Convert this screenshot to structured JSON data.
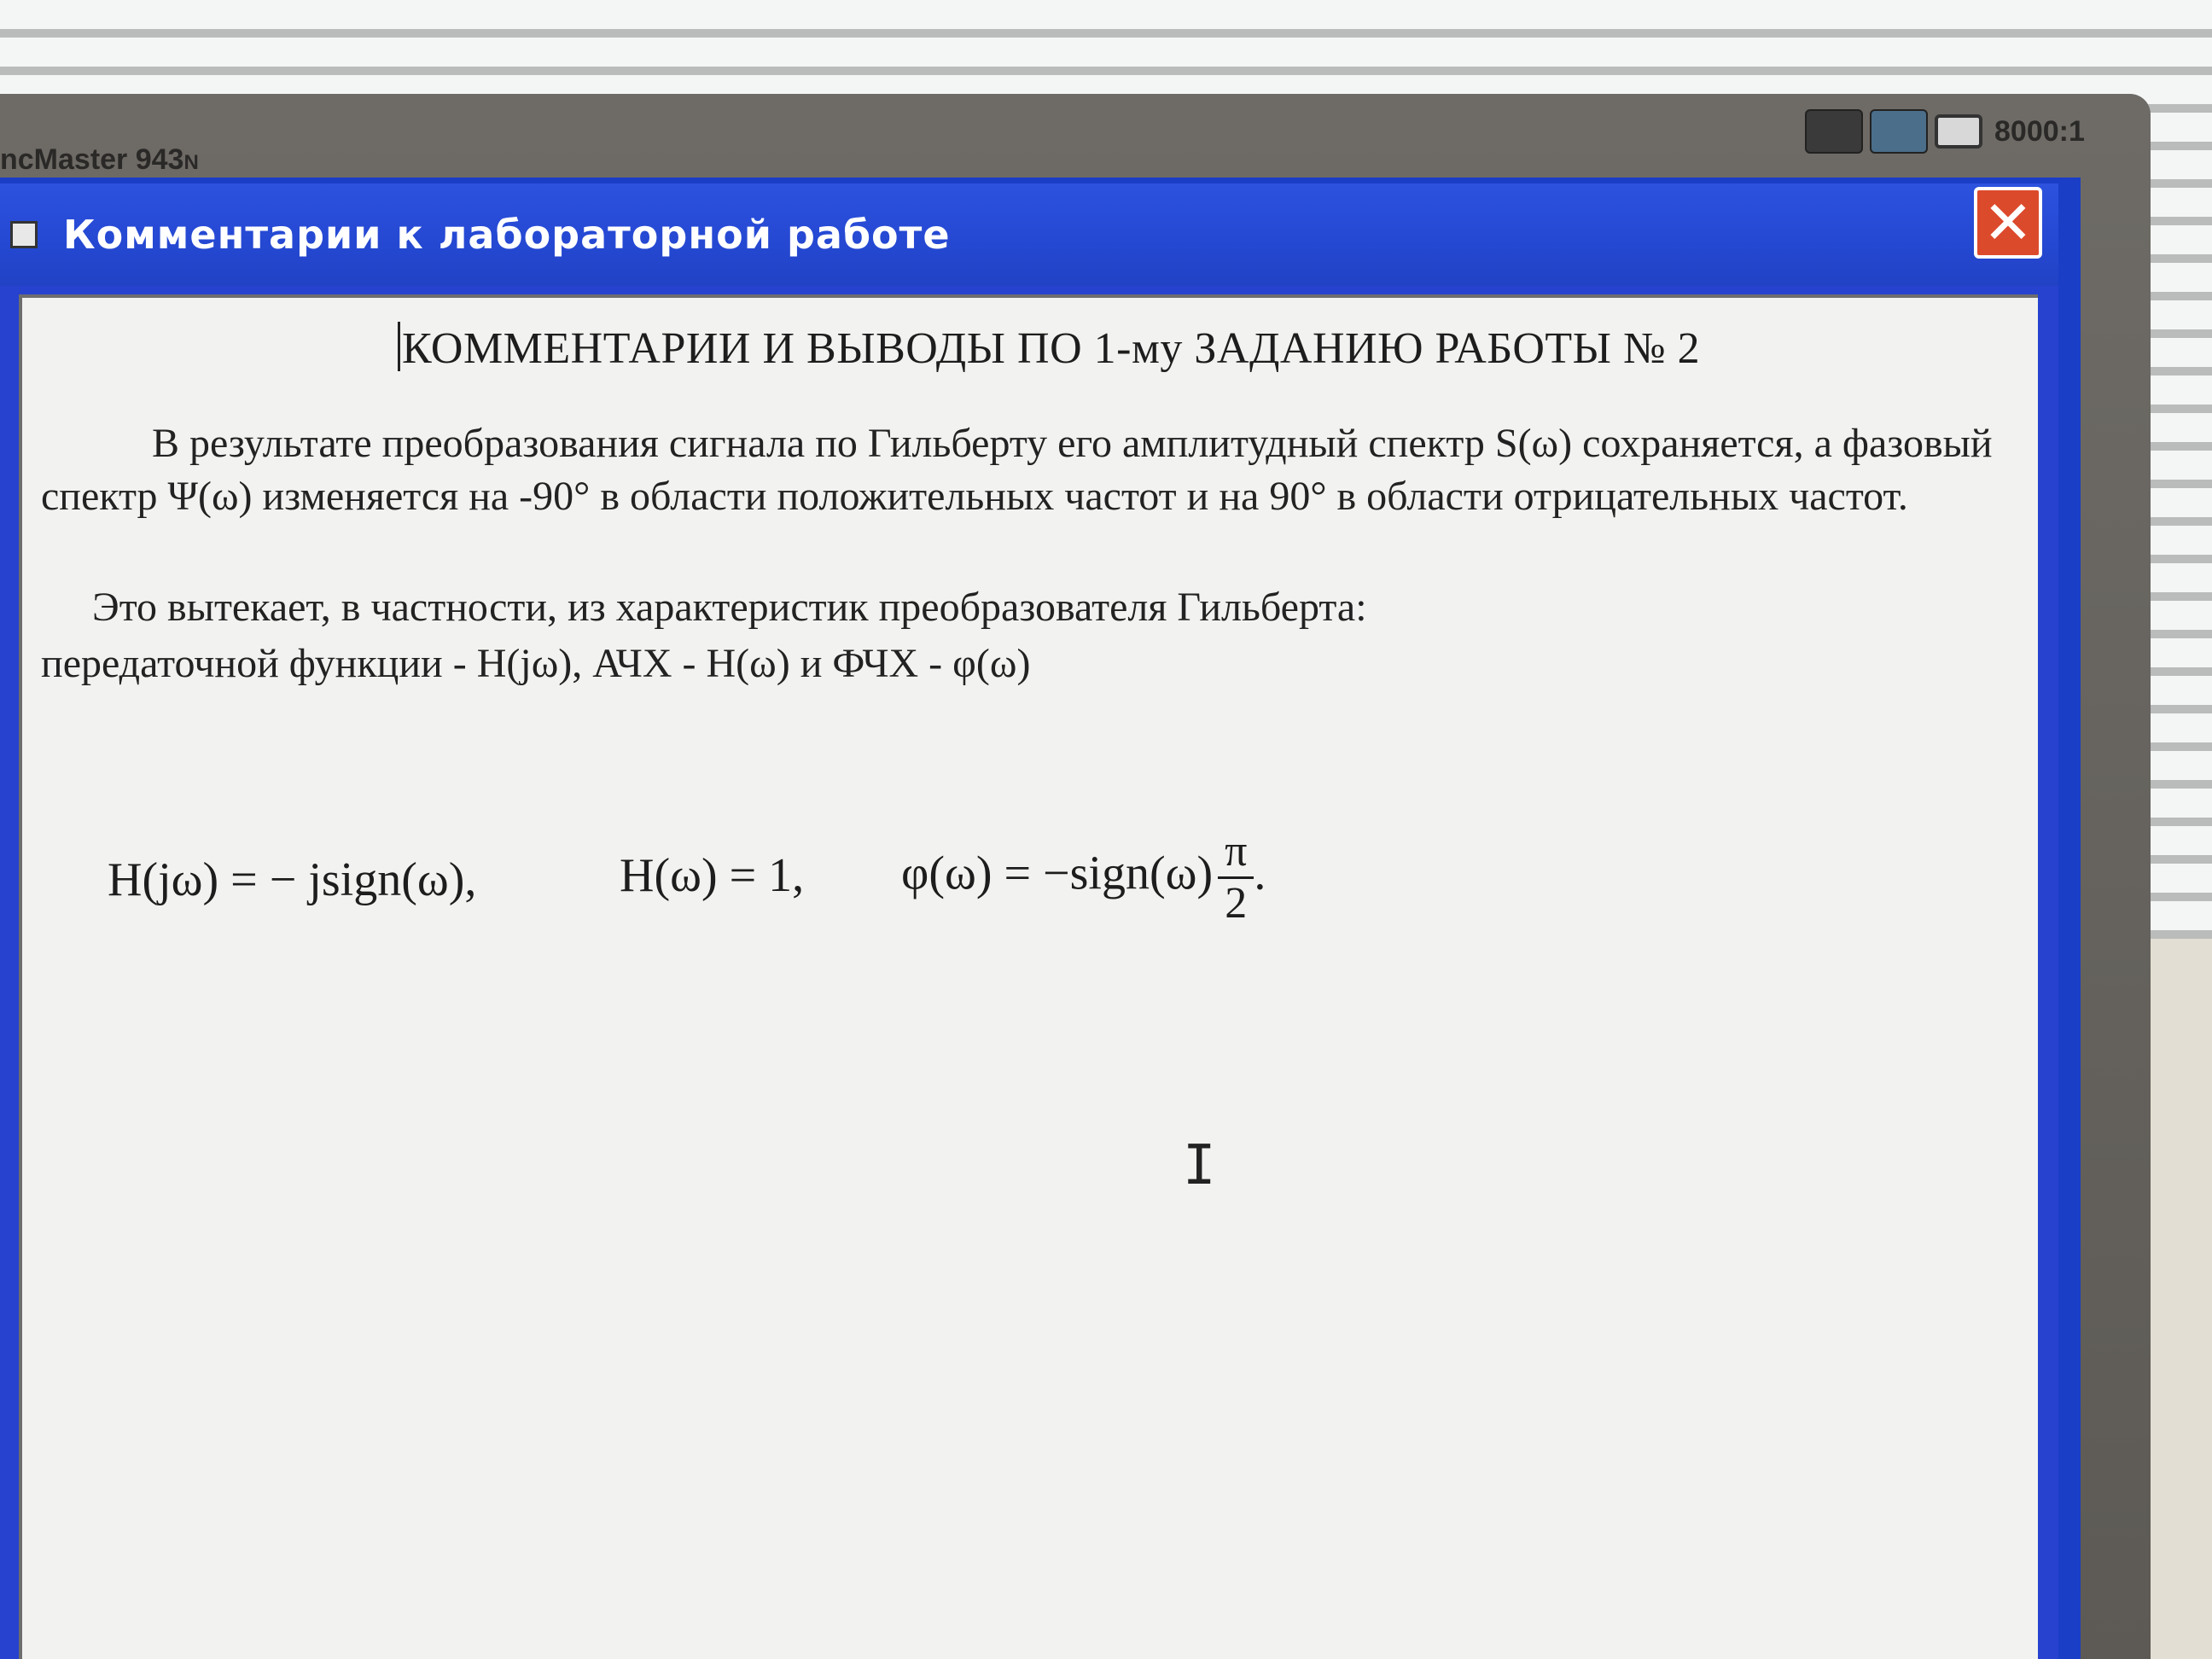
{
  "monitor": {
    "model_label": "ncMaster 943",
    "model_suffix": "N",
    "contrast_label": "8000:1"
  },
  "window": {
    "title": "Комментарии к лабораторной работе",
    "close_label": "✕"
  },
  "document": {
    "heading": "КОММЕНТАРИИ И ВЫВОДЫ ПО 1-му  ЗАДАНИЮ РАБОТЫ № 2",
    "paragraph1": "В результате преобразования сигнала по Гильберту его амплитудный спектр S(ω) сохраняется, а фазовый спектр Ψ(ω) изменяется на -90° в области положительных частот и на 90° в области отрицательных частот.",
    "paragraph2": "Это вытекает, в частности, из характеристик преобразователя Гильберта:",
    "paragraph3": "передаточной функции - H(jω), АЧХ - H(ω) и ФЧХ - φ(ω)",
    "formula1": "H(jω) = − jsign(ω),",
    "formula2": "H(ω) = 1,",
    "formula3_left": "φ(ω) = −sign(ω)",
    "formula3_num": "π",
    "formula3_den": "2",
    "formula3_tail": "."
  },
  "cursor": {
    "ibeam_glyph": "I"
  }
}
